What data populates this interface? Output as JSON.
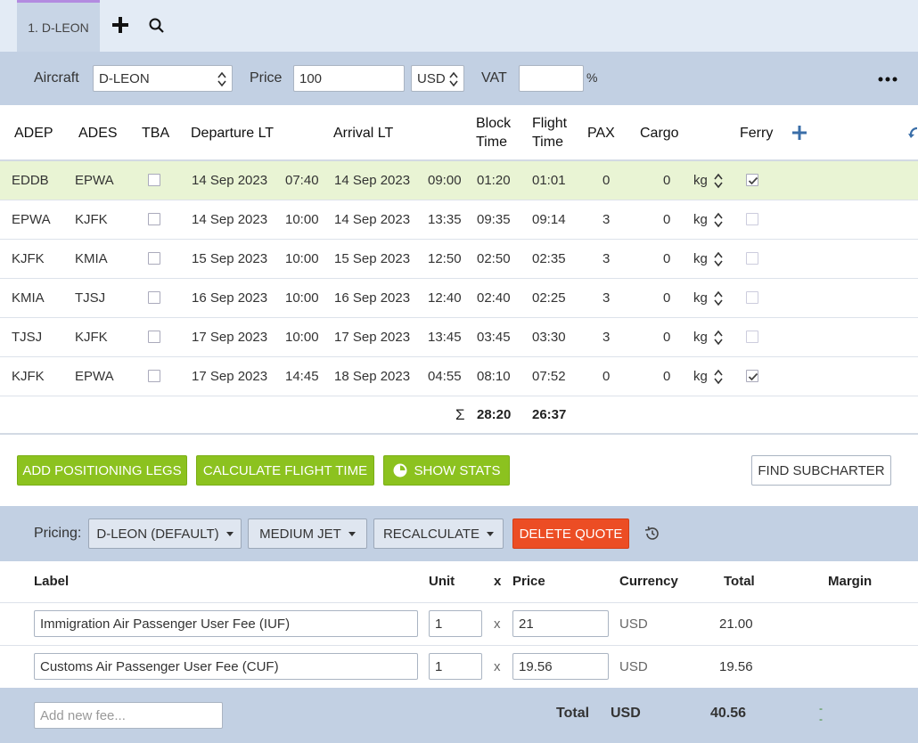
{
  "tabs": [
    {
      "label": "1. D-LEON"
    }
  ],
  "aircraft_bar": {
    "aircraft_label": "Aircraft",
    "aircraft_value": "D-LEON",
    "price_label": "Price",
    "price_value": "100",
    "currency_value": "USD",
    "vat_label": "VAT",
    "vat_value": "",
    "percent": "%"
  },
  "legs": {
    "headers": {
      "adep": "ADEP",
      "ades": "ADES",
      "tba": "TBA",
      "departure": "Departure LT",
      "arrival": "Arrival LT",
      "block1": "Block",
      "block2": "Time",
      "flight1": "Flight",
      "flight2": "Time",
      "pax": "PAX",
      "cargo": "Cargo",
      "ferry": "Ferry"
    },
    "rows": [
      {
        "adep": "EDDB",
        "ades": "EPWA",
        "dep_date": "14 Sep 2023",
        "dep_time": "07:40",
        "arr_date": "14 Sep 2023",
        "arr_time": "09:00",
        "block": "01:20",
        "flight": "01:01",
        "pax": "0",
        "cargo": "0",
        "unit": "kg",
        "ferry": true,
        "tba": false,
        "selected": true
      },
      {
        "adep": "EPWA",
        "ades": "KJFK",
        "dep_date": "14 Sep 2023",
        "dep_time": "10:00",
        "arr_date": "14 Sep 2023",
        "arr_time": "13:35",
        "block": "09:35",
        "flight": "09:14",
        "pax": "3",
        "cargo": "0",
        "unit": "kg",
        "ferry": false,
        "tba": false,
        "selected": false
      },
      {
        "adep": "KJFK",
        "ades": "KMIA",
        "dep_date": "15 Sep 2023",
        "dep_time": "10:00",
        "arr_date": "15 Sep 2023",
        "arr_time": "12:50",
        "block": "02:50",
        "flight": "02:35",
        "pax": "3",
        "cargo": "0",
        "unit": "kg",
        "ferry": false,
        "tba": false,
        "selected": false
      },
      {
        "adep": "KMIA",
        "ades": "TJSJ",
        "dep_date": "16 Sep 2023",
        "dep_time": "10:00",
        "arr_date": "16 Sep 2023",
        "arr_time": "12:40",
        "block": "02:40",
        "flight": "02:25",
        "pax": "3",
        "cargo": "0",
        "unit": "kg",
        "ferry": false,
        "tba": false,
        "selected": false
      },
      {
        "adep": "TJSJ",
        "ades": "KJFK",
        "dep_date": "17 Sep 2023",
        "dep_time": "10:00",
        "arr_date": "17 Sep 2023",
        "arr_time": "13:45",
        "block": "03:45",
        "flight": "03:30",
        "pax": "3",
        "cargo": "0",
        "unit": "kg",
        "ferry": false,
        "tba": false,
        "selected": false
      },
      {
        "adep": "KJFK",
        "ades": "EPWA",
        "dep_date": "17 Sep 2023",
        "dep_time": "14:45",
        "arr_date": "18 Sep 2023",
        "arr_time": "04:55",
        "block": "08:10",
        "flight": "07:52",
        "pax": "0",
        "cargo": "0",
        "unit": "kg",
        "ferry": true,
        "tba": false,
        "selected": false
      }
    ],
    "totals": {
      "sigma": "Σ",
      "block": "28:20",
      "flight": "26:37"
    }
  },
  "actions": {
    "add_positioning": "ADD POSITIONING LEGS",
    "calculate": "CALCULATE FLIGHT TIME",
    "show_stats": "SHOW STATS",
    "find_subcharter": "FIND SUBCHARTER"
  },
  "pricing": {
    "label": "Pricing:",
    "profile": "D-LEON (DEFAULT)",
    "category": "MEDIUM JET",
    "recalculate": "RECALCULATE",
    "delete": "DELETE QUOTE"
  },
  "fees": {
    "headers": {
      "label": "Label",
      "unit": "Unit",
      "x": "x",
      "price": "Price",
      "currency": "Currency",
      "total": "Total",
      "margin": "Margin"
    },
    "rows": [
      {
        "label": "Immigration Air Passenger User Fee (IUF)",
        "unit": "1",
        "x": "x",
        "price": "21",
        "currency": "USD",
        "total": "21.00"
      },
      {
        "label": "Customs Air Passenger User Fee (CUF)",
        "unit": "1",
        "x": "x",
        "price": "19.56",
        "currency": "USD",
        "total": "19.56"
      }
    ],
    "new_placeholder": "Add new fee...",
    "total_label": "Total",
    "total_currency": "USD",
    "total_value": "40.56",
    "margin_value": "-"
  },
  "colors": {
    "accent_green": "#8cc21f",
    "danger": "#ec4d24",
    "selected_row": "#e9f4d4",
    "bar": "#c2d0e3"
  }
}
